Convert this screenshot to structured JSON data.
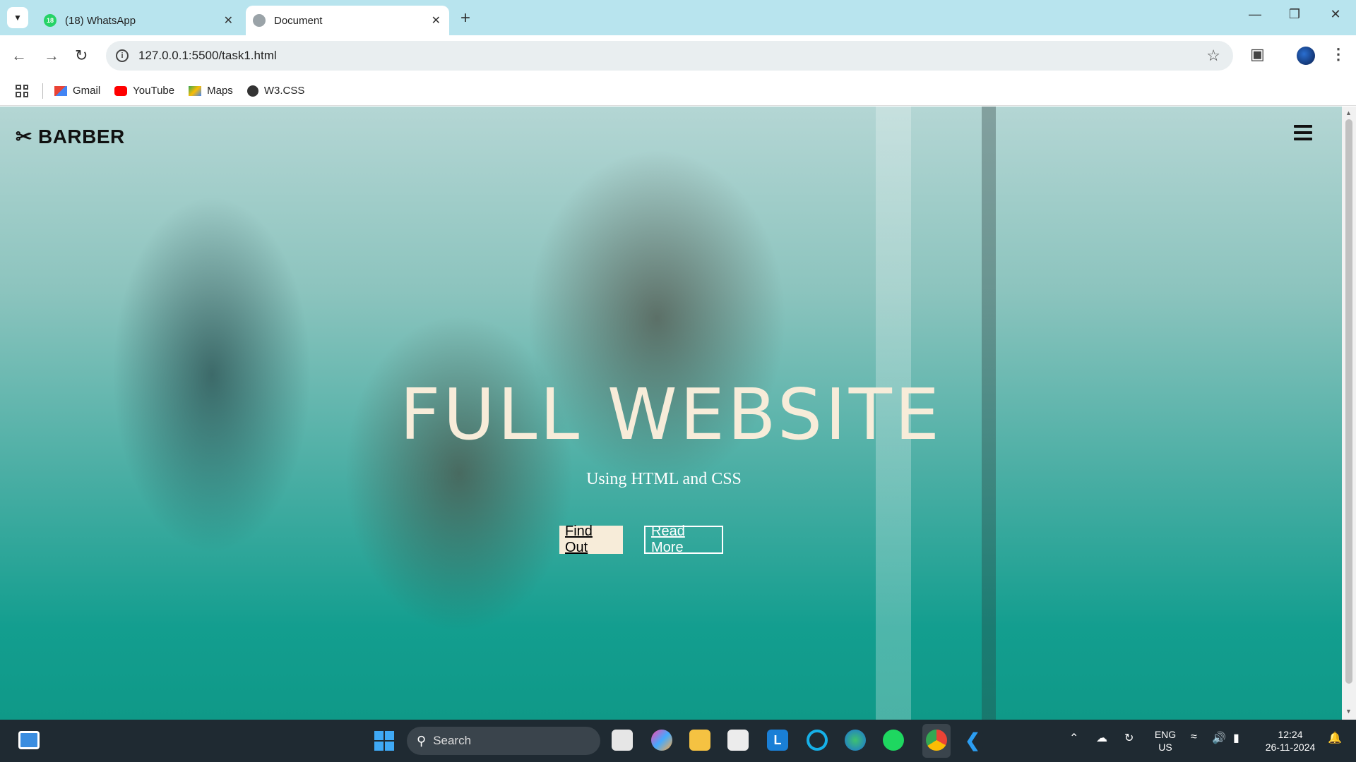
{
  "browser": {
    "tabs": [
      {
        "title": "(18) WhatsApp",
        "badge": "18",
        "active": false
      },
      {
        "title": "Document",
        "active": true
      }
    ],
    "url": "127.0.0.1:5500/task1.html",
    "bookmarks": [
      {
        "label": "Gmail",
        "icon": "gmail-icon"
      },
      {
        "label": "YouTube",
        "icon": "youtube-icon"
      },
      {
        "label": "Maps",
        "icon": "maps-icon"
      },
      {
        "label": "W3.CSS",
        "icon": "globe-icon"
      }
    ]
  },
  "page": {
    "logo": "BARBER",
    "hero_title": "FULL WEBSITE",
    "hero_subtitle": "Using HTML and CSS",
    "btn_find": "Find Out",
    "btn_read": "Read More",
    "colors": {
      "accent": "#0f9988",
      "cream": "#f7ecd9"
    }
  },
  "taskbar": {
    "search_placeholder": "Search",
    "lang_top": "ENG",
    "lang_bottom": "US",
    "time": "12:24",
    "date": "26-11-2024"
  }
}
